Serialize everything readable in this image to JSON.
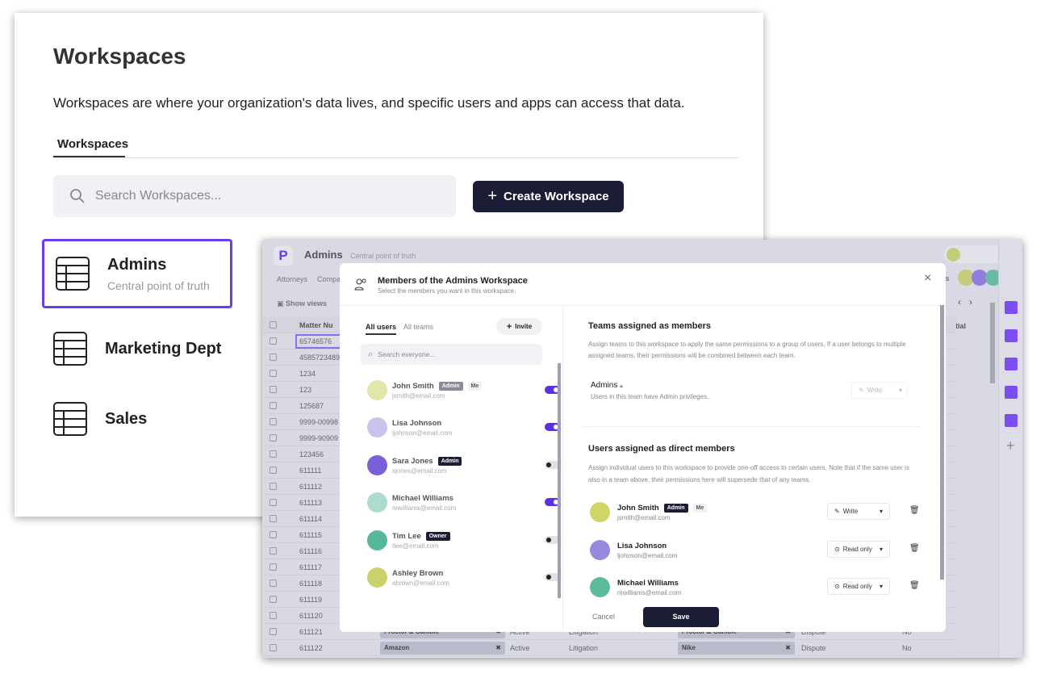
{
  "workspaces_page": {
    "title": "Workspaces",
    "description": "Workspaces are where your organization's data lives, and specific users and apps can access that data.",
    "tab": "Workspaces",
    "search_placeholder": "Search Workspaces...",
    "create_button": "Create Workspace",
    "items": [
      {
        "name": "Admins",
        "subtitle": "Central point of truth",
        "selected": true
      },
      {
        "name": "Marketing Dept",
        "subtitle": ""
      },
      {
        "name": "Sales",
        "subtitle": ""
      }
    ],
    "accent": "#6a3cf0"
  },
  "app": {
    "logo": "P",
    "workspace_name": "Admins",
    "workspace_subtitle": "Central point of truth",
    "nav": [
      "Attorneys",
      "Compa"
    ],
    "show_views": "Show views",
    "users_label": "ers",
    "column_header": "Matter Nu",
    "column_header_right": "nfidential",
    "matter_numbers": [
      "65746576",
      "4585723489",
      "1234",
      "123",
      "125687",
      "9999-00998",
      "9999-90909",
      "123456",
      "611111",
      "611112",
      "611113",
      "611114",
      "611115",
      "611116",
      "611117",
      "611118",
      "611119",
      "611120",
      "611121",
      "611122"
    ],
    "bottom_rows": [
      {
        "company": "Proctor & Gamble",
        "status": "Active",
        "type": "Litigation",
        "party": "Proctor & Gamble",
        "category": "Dispute",
        "confidential": "No"
      },
      {
        "company": "Amazon",
        "status": "Active",
        "type": "Litigation",
        "party": "Nike",
        "category": "Dispute",
        "confidential": "No"
      }
    ]
  },
  "modal": {
    "title": "Members of the Admins Workspace",
    "subtitle": "Select the members you want in this workspace.",
    "tabs": [
      "All users",
      "All teams"
    ],
    "invite": "Invite",
    "search_placeholder": "Search everyone...",
    "users": [
      {
        "name": "John Smith",
        "email": "jsmith@email.com",
        "badge": "Admin",
        "me": "Me",
        "enabled": true,
        "color": "#e2e6a8"
      },
      {
        "name": "Lisa Johnson",
        "email": "ljohnson@email.com",
        "enabled": true,
        "color": "#c9c3ee"
      },
      {
        "name": "Sara Jones",
        "email": "sjones@email.com",
        "badge": "Admin",
        "enabled": false,
        "color": "#7a5fd8"
      },
      {
        "name": "Michael Williams",
        "email": "mwilliams@email.com",
        "enabled": true,
        "color": "#acdccf"
      },
      {
        "name": "Tim Lee",
        "email": "tlee@email.com",
        "badge": "Owner",
        "enabled": false,
        "color": "#55b89a"
      },
      {
        "name": "Ashley Brown",
        "email": "abrown@email.com",
        "enabled": false,
        "color": "#cbd26b"
      }
    ],
    "teams_section": {
      "title": "Teams assigned as members",
      "description": "Assign teams to this workspace to apply the same permissions to a group of users. If a user belongs to multiple assigned teams, their permissions will be combined between each team.",
      "team_name": "Admins",
      "team_desc": "Users in this team have Admin privileges.",
      "team_permission": "Write"
    },
    "direct_section": {
      "title": "Users assigned as direct members",
      "description": "Assign individual users to this workspace to provide one-off access to certain users. Note that if the same user is also in a team above, their permissions here will supersede that of any teams.",
      "members": [
        {
          "name": "John Smith",
          "email": "jsmith@email.com",
          "badge": "Admin",
          "me": "Me",
          "permission": "Write",
          "color": "#cfd566"
        },
        {
          "name": "Lisa Johnson",
          "email": "ljohnson@email.com",
          "permission": "Read only",
          "color": "#958ae0"
        },
        {
          "name": "Michael Williams",
          "email": "mwilliams@email.com",
          "permission": "Read only",
          "color": "#5bbb9c"
        }
      ]
    },
    "cancel": "Cancel",
    "save": "Save"
  }
}
